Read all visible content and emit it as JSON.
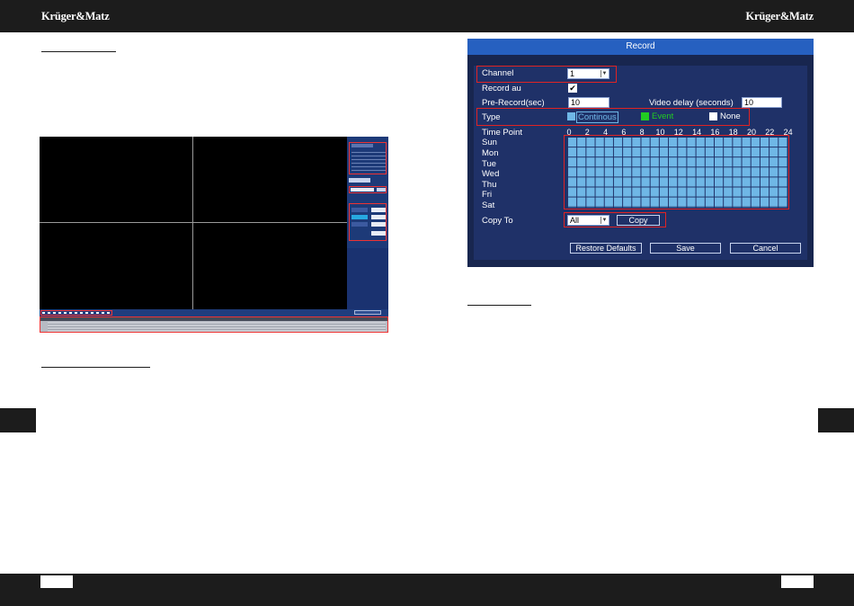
{
  "header": {
    "brand_left": "Krüger&Matz",
    "brand_right": "Krüger&Matz"
  },
  "record_dialog": {
    "title": "Record",
    "channel_label": "Channel",
    "channel_value": "1",
    "record_label": "Record au",
    "record_checked": true,
    "prerecord_label": "Pre-Record(sec)",
    "prerecord_value": "10",
    "video_delay_label": "Video delay (seconds)",
    "video_delay_value": "10",
    "type_label": "Type",
    "type_options": [
      {
        "label": "Continous",
        "color": "#6fb7e6"
      },
      {
        "label": "Event",
        "color": "#22cc22"
      },
      {
        "label": "None",
        "color": "#ffffff"
      }
    ],
    "time_point_label": "Time Point",
    "time_ticks": [
      "0",
      "2",
      "4",
      "6",
      "8",
      "10",
      "12",
      "14",
      "16",
      "18",
      "20",
      "22",
      "24"
    ],
    "days": [
      "Sun",
      "Mon",
      "Tue",
      "Wed",
      "Thu",
      "Fri",
      "Sat"
    ],
    "copy_to_label": "Copy To",
    "copy_to_value": "All",
    "copy_button": "Copy",
    "restore_button": "Restore Defaults",
    "save_button": "Save",
    "cancel_button": "Cancel"
  },
  "colors": {
    "dialog_bg": "#1f3168",
    "title_bar": "#2660c0",
    "schedule_cell": "#6fb7e6",
    "highlight": "#e02323"
  }
}
